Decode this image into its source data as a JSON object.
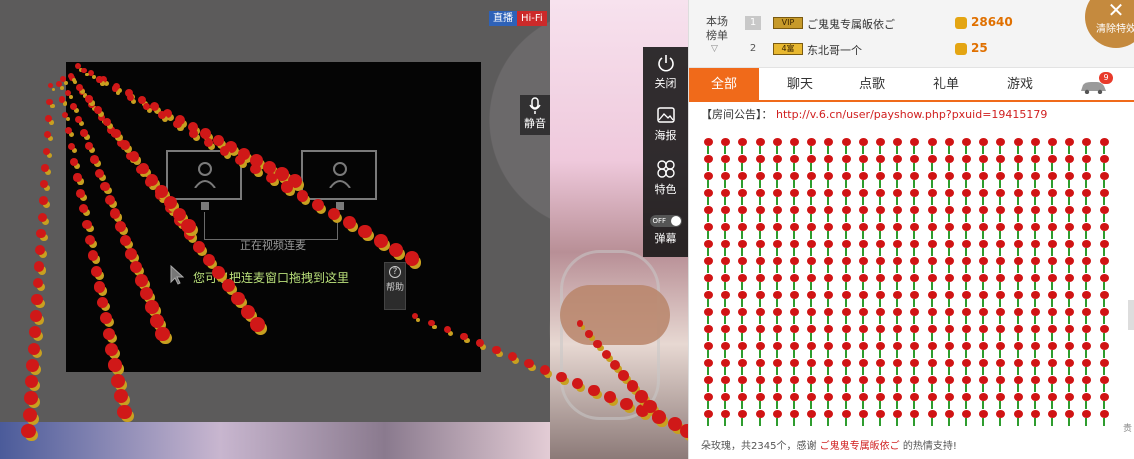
{
  "video": {
    "badge_live": "直播",
    "badge_hifi": "Hi-Fi",
    "status_text": "正在视频连麦",
    "hint_text": "您可以把连麦窗口拖拽到这里",
    "help_label": "帮助",
    "mute_label": "静音",
    "tools": [
      {
        "label": "关闭",
        "icon": "power-icon"
      },
      {
        "label": "海报",
        "icon": "poster-icon"
      },
      {
        "label": "特色",
        "icon": "effects-icon"
      },
      {
        "label": "弹幕",
        "icon": "danmaku-toggle",
        "toggle": "OFF"
      }
    ]
  },
  "panel": {
    "rank_title": "本场榜单",
    "rank_rows": [
      {
        "rank": "1",
        "level": "VIP",
        "name": "ご鬼鬼专属皈依ご",
        "score": "28640"
      },
      {
        "rank": "2",
        "level": "4富",
        "name": "东北哥一个",
        "score": "25"
      }
    ],
    "close_fx_label": "清除特效",
    "tabs": [
      "全部",
      "聊天",
      "点歌",
      "礼单",
      "游戏"
    ],
    "car_badge": "9",
    "notice_prefix": "【房间公告】：",
    "notice_url": "http://v.6.cn/user/payshow.php?pxuid=19415179",
    "thanks_prefix": "朵玫瑰，共2345个，感谢",
    "thanks_name": "ご鬼鬼专属皈依ご",
    "thanks_suffix": "的热情支持!",
    "side_tag": "贵"
  },
  "colors": {
    "accent": "#f06a1a",
    "rose": "#d01414",
    "stem": "#2e9c2e",
    "score": "#e07000"
  }
}
